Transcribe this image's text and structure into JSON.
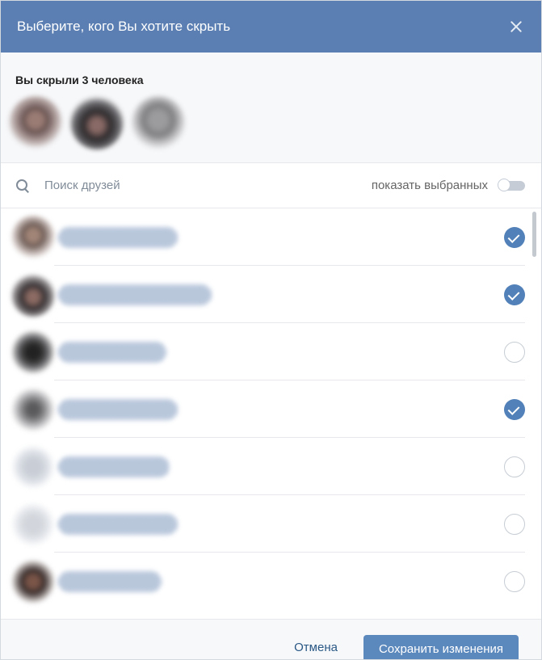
{
  "dialog": {
    "title": "Выберите, кого Вы хотите скрыть",
    "colors": {
      "header": "#5b7fb2",
      "accent": "#5181b8"
    }
  },
  "hidden": {
    "title": "Вы скрыли 3 человека"
  },
  "search": {
    "placeholder": "Поиск друзей",
    "show_selected_label": "показать выбранных",
    "show_selected_on": false
  },
  "friends": [
    {
      "checked": true
    },
    {
      "checked": true
    },
    {
      "checked": false
    },
    {
      "checked": true
    },
    {
      "checked": false
    },
    {
      "checked": false
    },
    {
      "checked": false
    }
  ],
  "footer": {
    "cancel_label": "Отмена",
    "save_label": "Сохранить изменения"
  }
}
